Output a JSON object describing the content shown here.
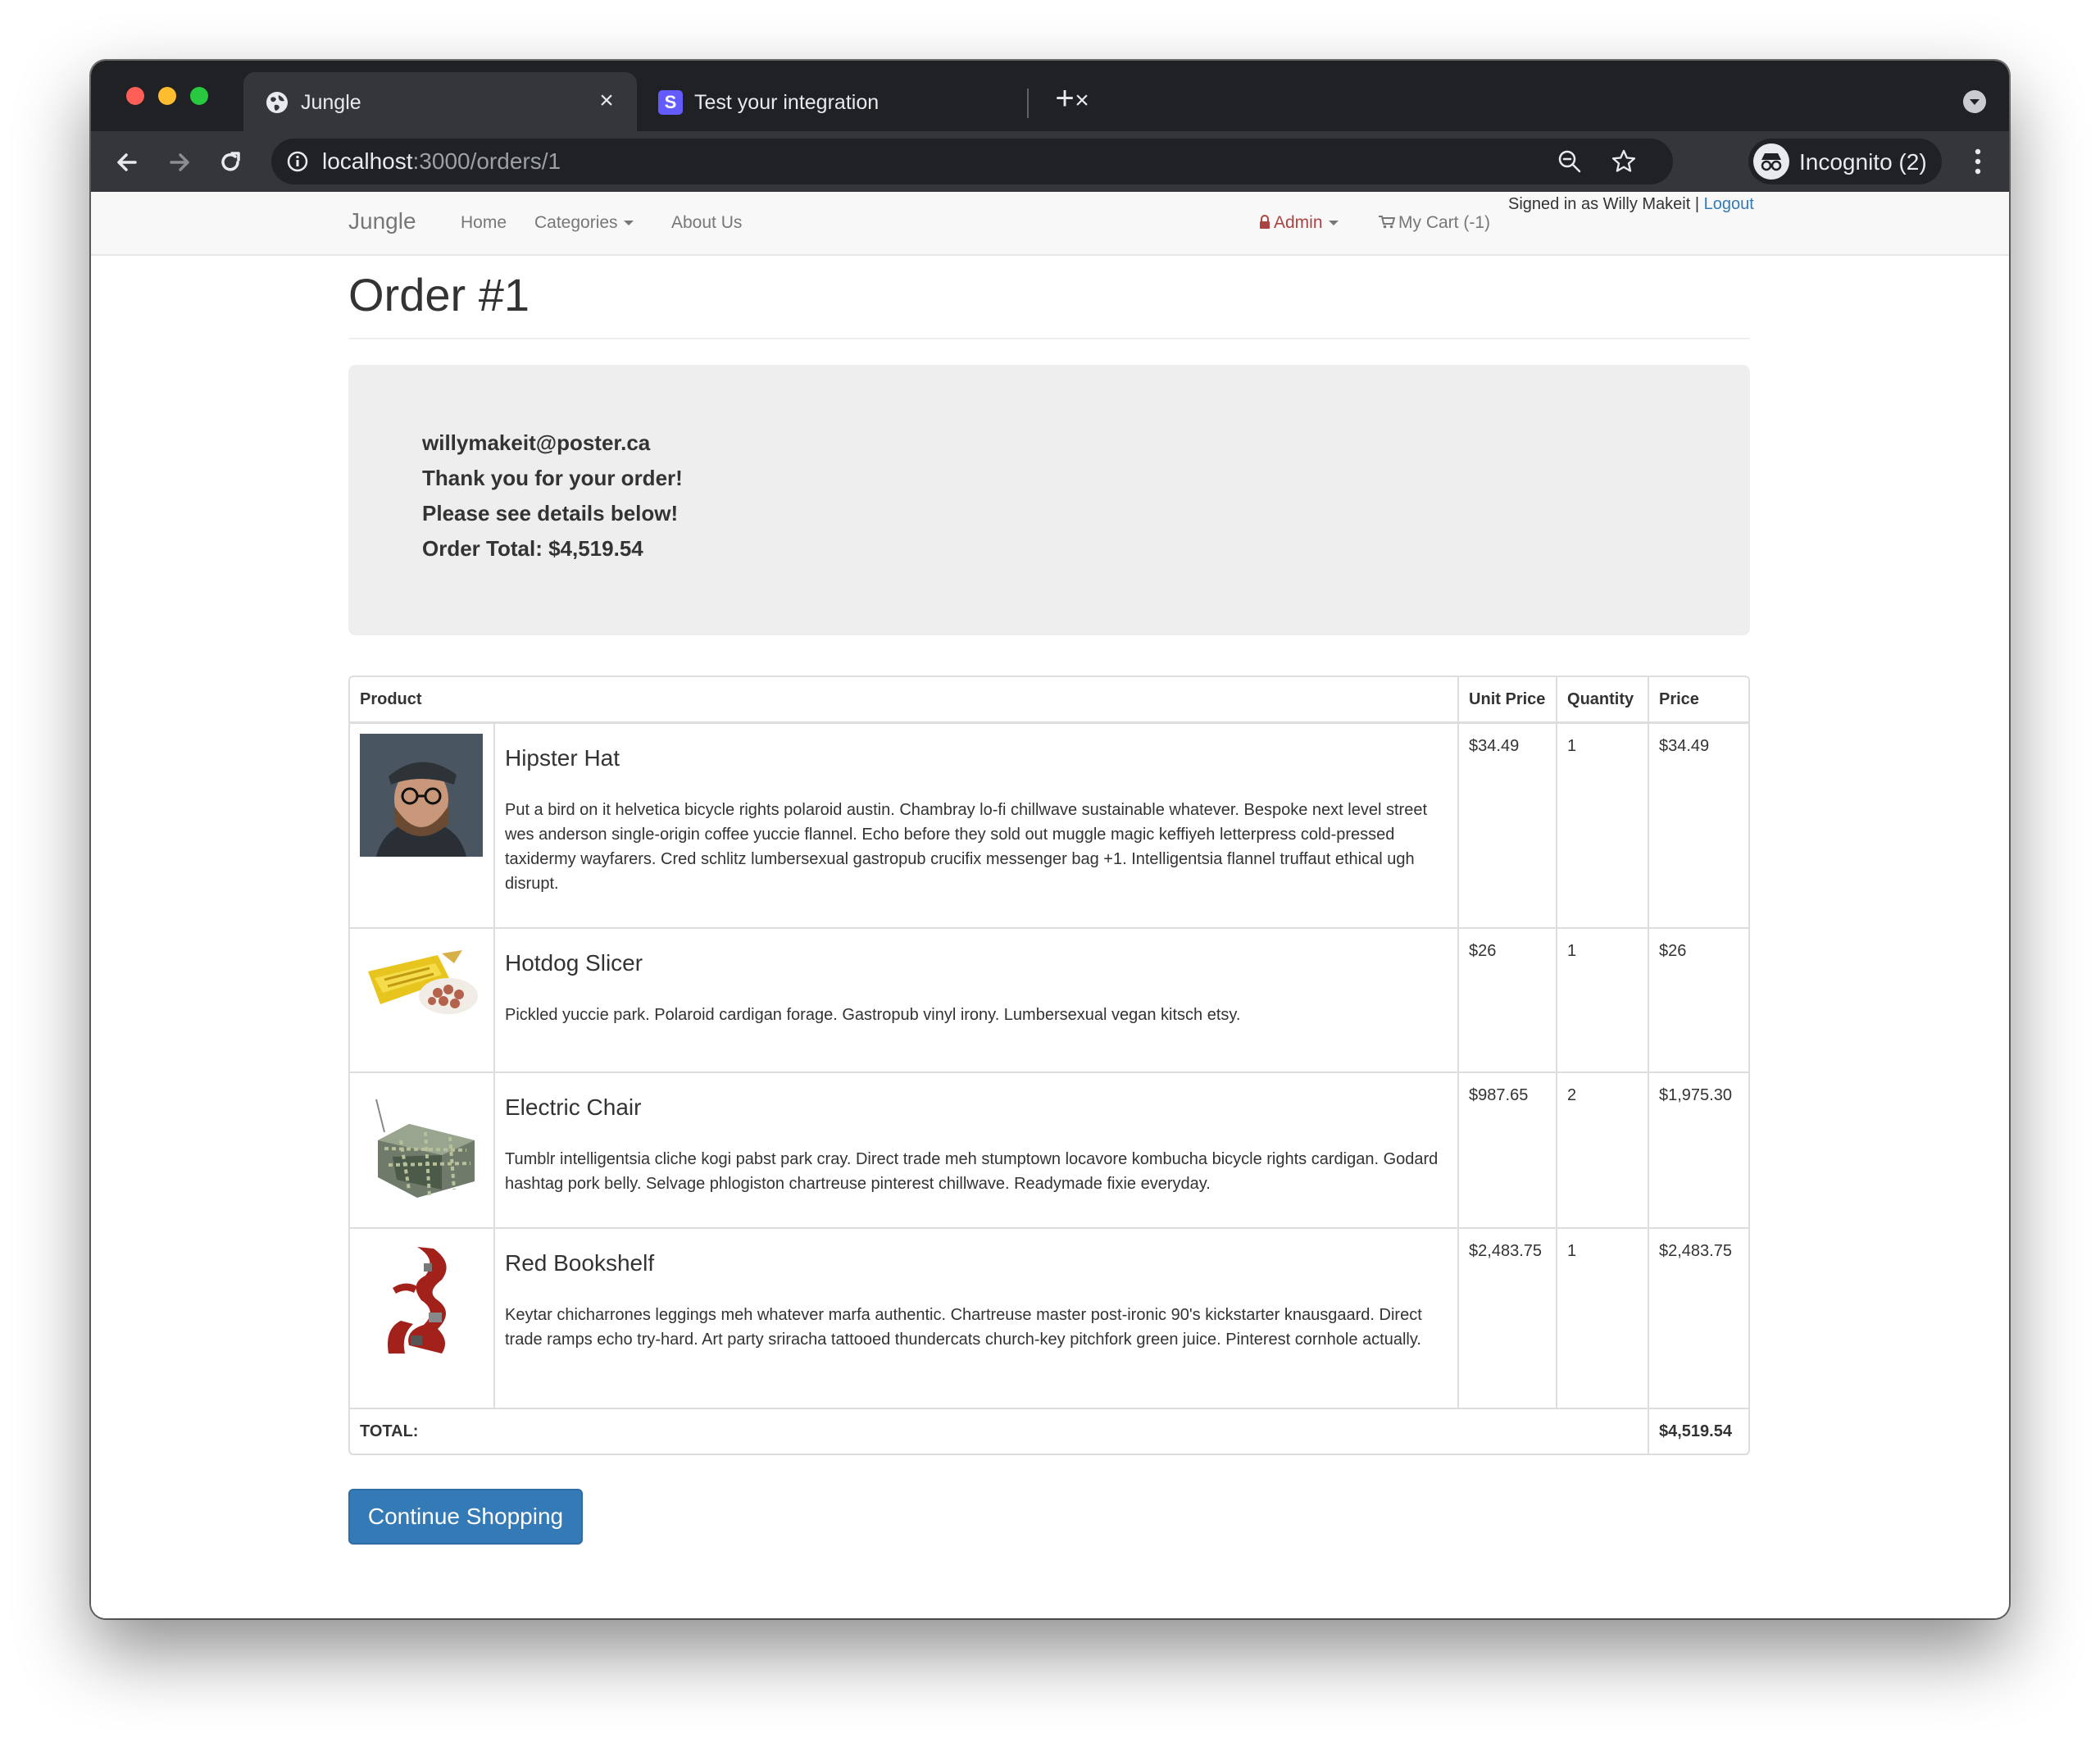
{
  "browser": {
    "tabs": [
      {
        "title": "Jungle",
        "active": true,
        "favicon": "globe-icon"
      },
      {
        "title": "Test your integration",
        "active": false,
        "favicon": "stripe-s-icon",
        "favicon_letter": "S"
      }
    ],
    "url_host": "localhost",
    "url_path": ":3000/orders/1",
    "incognito_label": "Incognito (2)"
  },
  "navbar": {
    "brand": "Jungle",
    "home": "Home",
    "categories": "Categories",
    "about": "About Us",
    "admin": "Admin",
    "cart": "My Cart (-1)",
    "signed_in": "Signed in as Willy Makeit",
    "separator": "|",
    "logout": "Logout"
  },
  "order": {
    "title": "Order #1",
    "email": "willymakeit@poster.ca",
    "thanks": "Thank you for your order!",
    "details": "Please see details below!",
    "total_line": "Order Total: $4,519.54"
  },
  "table": {
    "headers": {
      "product": "Product",
      "unit_price": "Unit Price",
      "quantity": "Quantity",
      "price": "Price"
    },
    "rows": [
      {
        "name": "Hipster Hat",
        "description": "Put a bird on it helvetica bicycle rights polaroid austin. Chambray lo-fi chillwave sustainable whatever. Bespoke next level street wes anderson single-origin coffee yuccie flannel. Echo before they sold out muggle magic keffiyeh letterpress cold-pressed taxidermy wayfarers. Cred schlitz lumbersexual gastropub crucifix messenger bag +1. Intelligentsia flannel truffaut ethical ugh disrupt.",
        "unit_price": "$34.49",
        "quantity": "1",
        "price": "$34.49"
      },
      {
        "name": "Hotdog Slicer",
        "description": "Pickled yuccie park. Polaroid cardigan forage. Gastropub vinyl irony. Lumbersexual vegan kitsch etsy.",
        "unit_price": "$26",
        "quantity": "1",
        "price": "$26"
      },
      {
        "name": "Electric Chair",
        "description": "Tumblr intelligentsia cliche kogi pabst park cray. Direct trade meh stumptown locavore kombucha bicycle rights cardigan. Godard hashtag pork belly. Selvage phlogiston chartreuse pinterest chillwave. Readymade fixie everyday.",
        "unit_price": "$987.65",
        "quantity": "2",
        "price": "$1,975.30"
      },
      {
        "name": "Red Bookshelf",
        "description": "Keytar chicharrones leggings meh whatever marfa authentic. Chartreuse master post-ironic 90's kickstarter knausgaard. Direct trade ramps echo try-hard. Art party sriracha tattooed thundercats church-key pitchfork green juice. Pinterest cornhole actually.",
        "unit_price": "$2,483.75",
        "quantity": "1",
        "price": "$2,483.75"
      }
    ],
    "total_label": "TOTAL:",
    "total_value": "$4,519.54"
  },
  "continue_button": "Continue Shopping",
  "colors": {
    "link": "#337ab7",
    "admin": "#a94442",
    "button": "#337ab7"
  }
}
